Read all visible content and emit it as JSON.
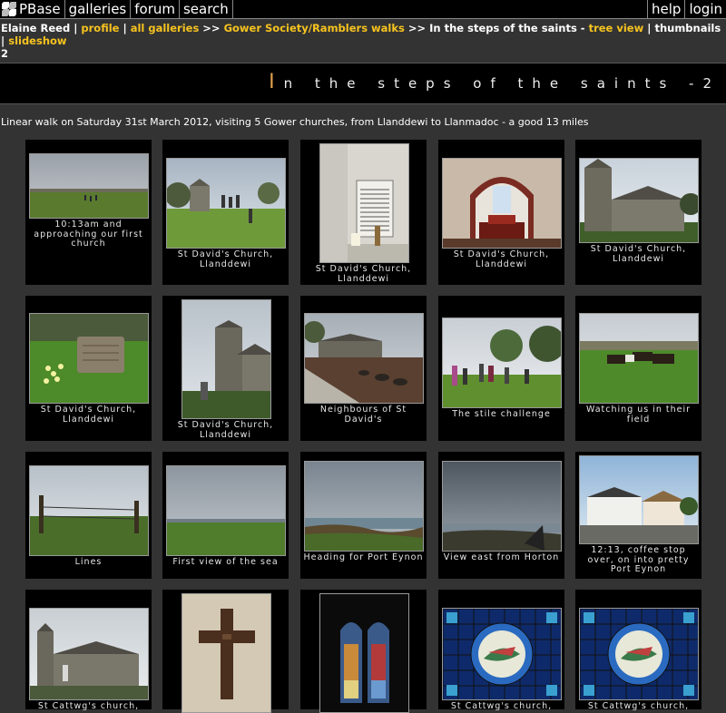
{
  "nav": {
    "logo_text": "PBase",
    "items": [
      "galleries",
      "forum",
      "search"
    ],
    "right_items": [
      "help",
      "login"
    ]
  },
  "breadcrumb": {
    "owner": "Elaine Reed",
    "sep1": " | ",
    "profile": "profile",
    "sep2": " | ",
    "all_galleries": "all galleries",
    "sep3": " >> ",
    "gallery": "Gower Society/Ramblers walks",
    "sep4": " >> In the steps of the saints - ",
    "tree_view": "tree view",
    "sep5": " | thumbnails | ",
    "slideshow": "slideshow",
    "page": "2"
  },
  "title": {
    "first_letter": "I",
    "rest": "n the steps of the saints -2"
  },
  "description": "Linear walk on Saturday 31st March 2012, visiting 5 Gower churches, from Llanddewi to Llanmadoc - a good 13 miles",
  "thumbnails": [
    {
      "caption": "10:13am and approaching our first church",
      "scene": "field"
    },
    {
      "caption": "St David's Church, Llanddewi",
      "scene": "church_walkers"
    },
    {
      "caption": "St David's Church, Llanddewi",
      "scene": "plaque"
    },
    {
      "caption": "St David's Church, Llanddewi",
      "scene": "interior"
    },
    {
      "caption": "St David's Church, Llanddewi",
      "scene": "church"
    },
    {
      "caption": "St David's Church, Llanddewi",
      "scene": "gravestone"
    },
    {
      "caption": "St David's Church, Llanddewi",
      "scene": "tower"
    },
    {
      "caption": "Neighbours of St David's",
      "scene": "farm"
    },
    {
      "caption": "The stile challenge",
      "scene": "stile"
    },
    {
      "caption": "Watching us in their field",
      "scene": "horses"
    },
    {
      "caption": "Lines",
      "scene": "lines"
    },
    {
      "caption": "First view of the sea",
      "scene": "sea_field"
    },
    {
      "caption": "Heading for Port Eynon",
      "scene": "coast"
    },
    {
      "caption": "View east from Horton",
      "scene": "storm"
    },
    {
      "caption": "12:13, coffee stop over, on into pretty Port Eynon",
      "scene": "cottages"
    },
    {
      "caption": "St Cattwg's church,",
      "scene": "church2"
    },
    {
      "caption": "",
      "scene": "cross"
    },
    {
      "caption": "",
      "scene": "window"
    },
    {
      "caption": "St Cattwg's church,",
      "scene": "stained1"
    },
    {
      "caption": "St Cattwg's church,",
      "scene": "stained2"
    }
  ]
}
